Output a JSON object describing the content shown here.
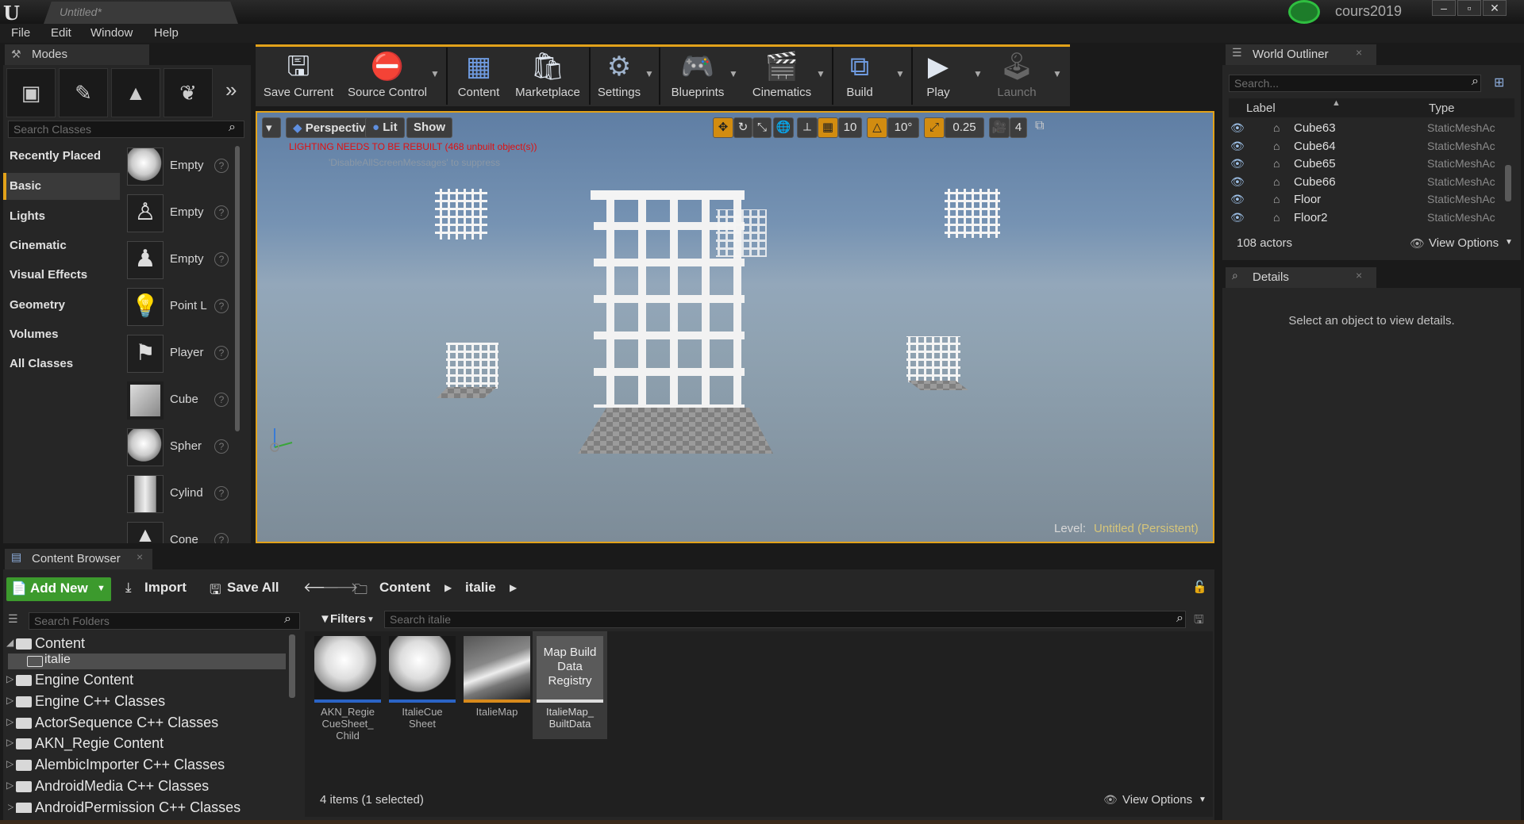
{
  "window": {
    "app_icon": "unreal-logo-icon",
    "doc_title": "Untitled*",
    "project": "cours2019",
    "controls": [
      "–",
      "▫",
      "✕"
    ]
  },
  "menu": [
    "File",
    "Edit",
    "Window",
    "Help"
  ],
  "modes": {
    "tab": "Modes",
    "tools": [
      "place-icon",
      "paint-icon",
      "landscape-icon",
      "foliage-icon"
    ],
    "search_placeholder": "Search Classes",
    "categories": [
      "Recently Placed",
      "Basic",
      "Lights",
      "Cinematic",
      "Visual Effects",
      "Geometry",
      "Volumes",
      "All Classes"
    ],
    "selected_category": "Basic",
    "items": [
      "Empty",
      "Empty",
      "Empty",
      "Point L",
      "Player",
      "Cube",
      "Spher",
      "Cylind",
      "Cone"
    ]
  },
  "toolbar": {
    "buttons": [
      "Save Current",
      "Source Control",
      "Content",
      "Marketplace",
      "Settings",
      "Blueprints",
      "Cinematics",
      "Build",
      "Play",
      "Launch"
    ]
  },
  "viewport": {
    "menu_icon": "▾",
    "perspective": "Perspective",
    "lit": "Lit",
    "show": "Show",
    "warning": "LIGHTING NEEDS TO BE REBUILT (468 unbuilt object(s))",
    "warning_sub": "'DisableAllScreenMessages' to suppress",
    "grid_snap": "10",
    "rot_snap": "10°",
    "scale_snap": "0.25",
    "cam_speed": "4",
    "level_label": "Level:",
    "level_value": "Untitled (Persistent)",
    "colors": {
      "border": "#e2a21a",
      "warning": "#e01010"
    }
  },
  "outliner": {
    "tab": "World Outliner",
    "search_placeholder": "Search...",
    "col_label": "Label",
    "col_type": "Type",
    "rows": [
      {
        "name": "Cube63",
        "type": "StaticMeshAc"
      },
      {
        "name": "Cube64",
        "type": "StaticMeshAc"
      },
      {
        "name": "Cube65",
        "type": "StaticMeshAc"
      },
      {
        "name": "Cube66",
        "type": "StaticMeshAc"
      },
      {
        "name": "Floor",
        "type": "StaticMeshAc"
      },
      {
        "name": "Floor2",
        "type": "StaticMeshAc"
      }
    ],
    "count": "108 actors",
    "view_options": "View Options"
  },
  "details": {
    "tab": "Details",
    "message": "Select an object to view details."
  },
  "content_browser": {
    "tab": "Content Browser",
    "add_new": "Add New",
    "import": "Import",
    "save_all": "Save All",
    "crumbs": [
      "Content",
      "italie"
    ],
    "folders_placeholder": "Search Folders",
    "filters": "Filters",
    "search_placeholder": "Search italie",
    "tree": [
      "Content",
      "italie",
      "Engine Content",
      "Engine C++ Classes",
      "ActorSequence C++ Classes",
      "AKN_Regie Content",
      "AlembicImporter C++ Classes",
      "AndroidMedia C++ Classes",
      "AndroidPermission C++ Classes"
    ],
    "assets": [
      {
        "name": "AKN_Regie\nCueSheet_\nChild",
        "thumb_text": ""
      },
      {
        "name": "ItalieCue\nSheet",
        "thumb_text": ""
      },
      {
        "name": "ItalieMap",
        "thumb_text": ""
      },
      {
        "name": "ItalieMap_\nBuiltData",
        "thumb_text": "Map Build\nData\nRegistry"
      }
    ],
    "status": "4 items (1 selected)",
    "view_options": "View Options"
  }
}
